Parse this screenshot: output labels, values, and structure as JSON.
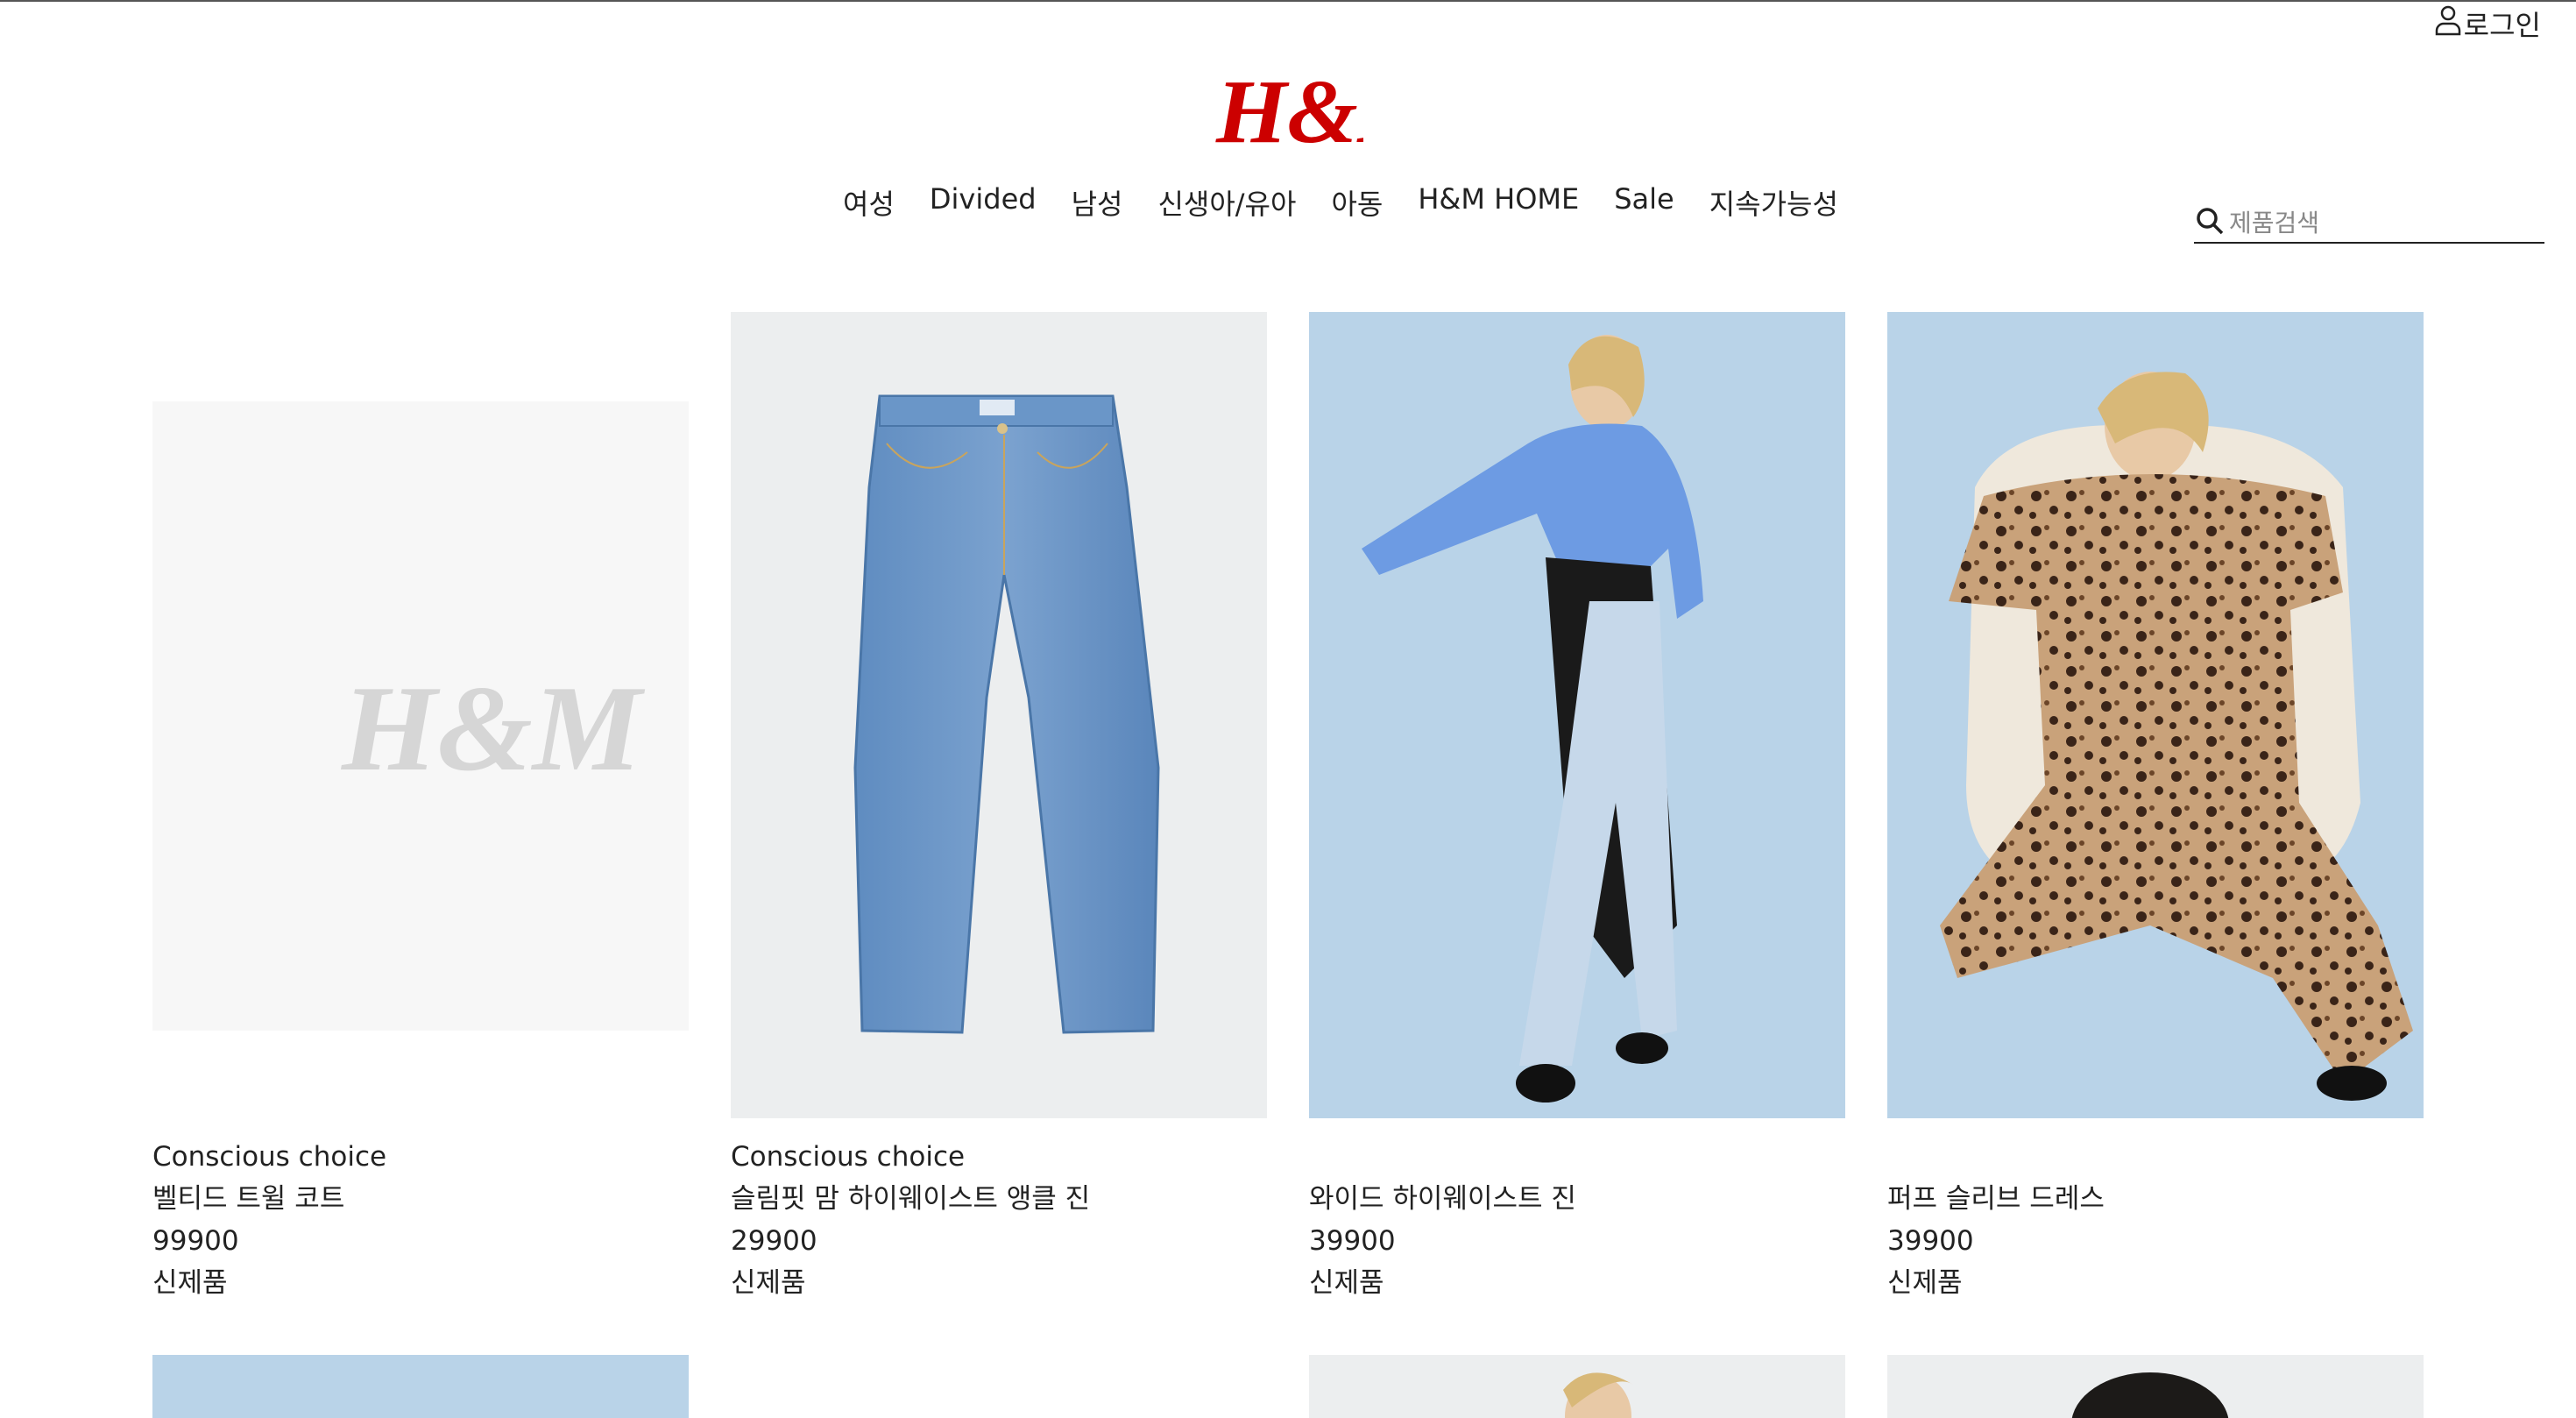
{
  "header": {
    "login_label": "로그인",
    "brand": "H&M",
    "brand_color": "#cc0000"
  },
  "nav": {
    "items": [
      {
        "label": "여성"
      },
      {
        "label": "Divided"
      },
      {
        "label": "남성"
      },
      {
        "label": "신생아/유아"
      },
      {
        "label": "아동"
      },
      {
        "label": "H&M HOME"
      },
      {
        "label": "Sale"
      },
      {
        "label": "지속가능성"
      }
    ]
  },
  "search": {
    "placeholder": "제품검색",
    "icon": "search-icon"
  },
  "products": [
    {
      "tag": "Conscious choice",
      "name": "벨티드 트윌 코트",
      "price": "99900",
      "badge": "신제품",
      "image": "placeholder-logo"
    },
    {
      "tag": "Conscious choice",
      "name": "슬림핏 맘 하이웨이스트 앵클 진",
      "price": "29900",
      "badge": "신제품",
      "image": "jeans"
    },
    {
      "tag": "",
      "name": "와이드 하이웨이스트 진",
      "price": "39900",
      "badge": "신제품",
      "image": "model-blue-sweater"
    },
    {
      "tag": "",
      "name": "퍼프 슬리브 드레스",
      "price": "39900",
      "badge": "신제품",
      "image": "model-leopard-dress"
    }
  ],
  "colors": {
    "image_bg_placeholder": "#f7f7f7",
    "image_bg_blue": "#b9d3e8",
    "image_bg_grey": "#eceeef"
  }
}
